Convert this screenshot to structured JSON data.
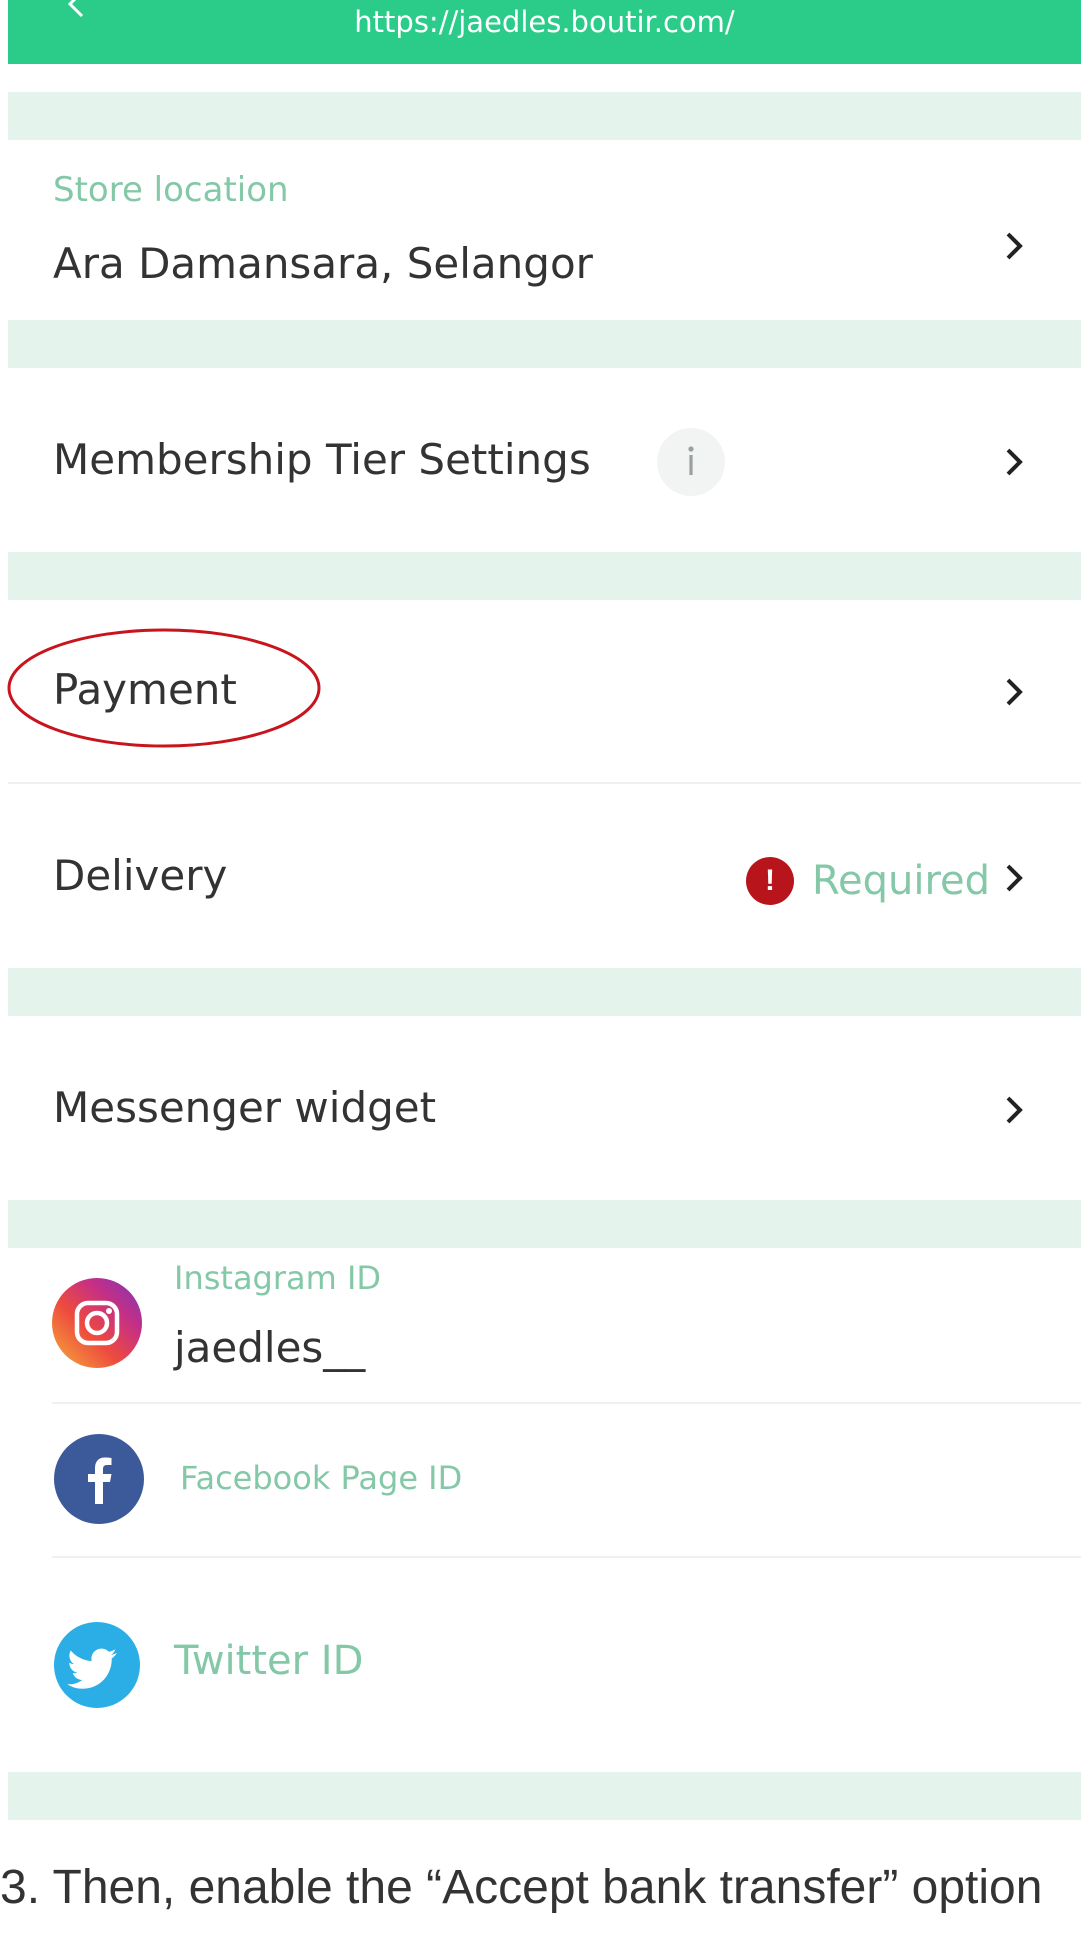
{
  "browser": {
    "url": "https://jaedles.boutir.com/"
  },
  "settings": {
    "store_location": {
      "label": "Store location",
      "value": "Ara Damansara, Selangor"
    },
    "membership": {
      "title": "Membership Tier Settings"
    },
    "payment": {
      "title": "Payment"
    },
    "delivery": {
      "title": "Delivery",
      "status": "Required"
    },
    "messenger": {
      "title": "Messenger widget"
    },
    "social": {
      "instagram": {
        "label": "Instagram ID",
        "value": "jaedles__"
      },
      "facebook": {
        "label": "Facebook Page ID"
      },
      "twitter": {
        "label": "Twitter ID"
      }
    }
  },
  "caption": {
    "text": "3. Then, enable the “Accept bank transfer” option"
  },
  "colors": {
    "accent_green": "#2bcc8a",
    "section_gap": "#e4f4ec",
    "label_green": "#84c8a7",
    "required_red": "#b8141c",
    "highlight_circle": "#c8141c"
  }
}
